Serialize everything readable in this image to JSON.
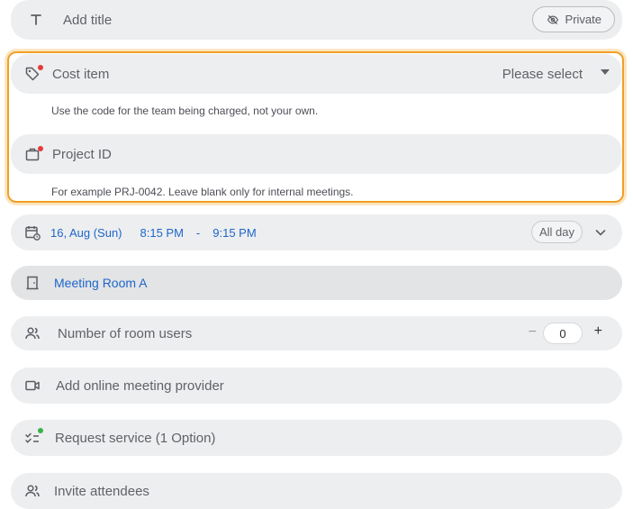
{
  "title_row": {
    "placeholder": "Add title",
    "private_label": "Private"
  },
  "cost_item": {
    "label": "Cost item",
    "select_placeholder": "Please select",
    "hint": "Use the code for the team being charged, not your own."
  },
  "project_id": {
    "label": "Project ID",
    "hint": "For example PRJ-0042. Leave blank only for internal meetings."
  },
  "datetime": {
    "date": "16, Aug (Sun)",
    "start": "8:15 PM",
    "separator": "-",
    "end": "9:15 PM",
    "allday_label": "All day"
  },
  "room": {
    "name": "Meeting Room A"
  },
  "room_users": {
    "label": "Number of room users",
    "minus": "−",
    "value": "0",
    "plus": "+"
  },
  "online_meeting": {
    "label": "Add online meeting provider"
  },
  "service": {
    "label": "Request service (1 Option)"
  },
  "attendees": {
    "label": "Invite attendees"
  },
  "colors": {
    "accent_blue": "#1e66c8",
    "highlight_orange": "#f0a025",
    "required_red": "#e43b3b",
    "status_green": "#3ab24a",
    "row_bg": "#edeef0"
  }
}
